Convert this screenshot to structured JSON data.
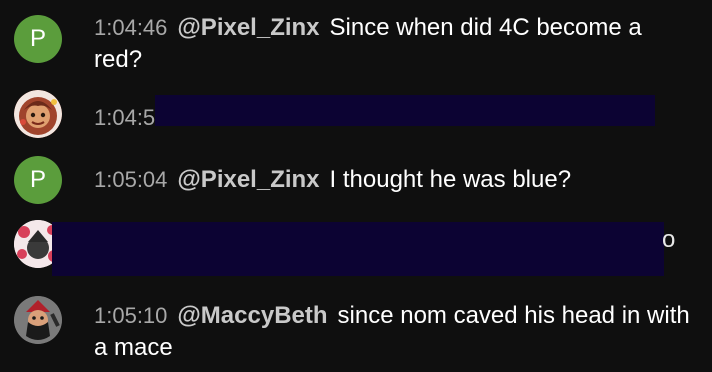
{
  "messages": [
    {
      "avatar_letter": "P",
      "timestamp": "1:04:46",
      "author": "@Pixel_Zinx",
      "text": "Since when did 4C become a red?"
    },
    {
      "timestamp": "1:04:5",
      "redacted": true
    },
    {
      "avatar_letter": "P",
      "timestamp": "1:05:04",
      "author": "@Pixel_Zinx",
      "text": "I thought he was blue?"
    },
    {
      "peek_char": "o",
      "redacted": true
    },
    {
      "timestamp": "1:05:10",
      "author": "@MaccyBeth",
      "text": "since nom caved his head in with a mace"
    }
  ],
  "colors": {
    "background": "#0f0f0f",
    "avatar_green": "#5b9d3c",
    "redaction": "#0c0333",
    "timestamp": "#a8a8a8",
    "author": "#c9c9c9",
    "text": "#ffffff"
  }
}
